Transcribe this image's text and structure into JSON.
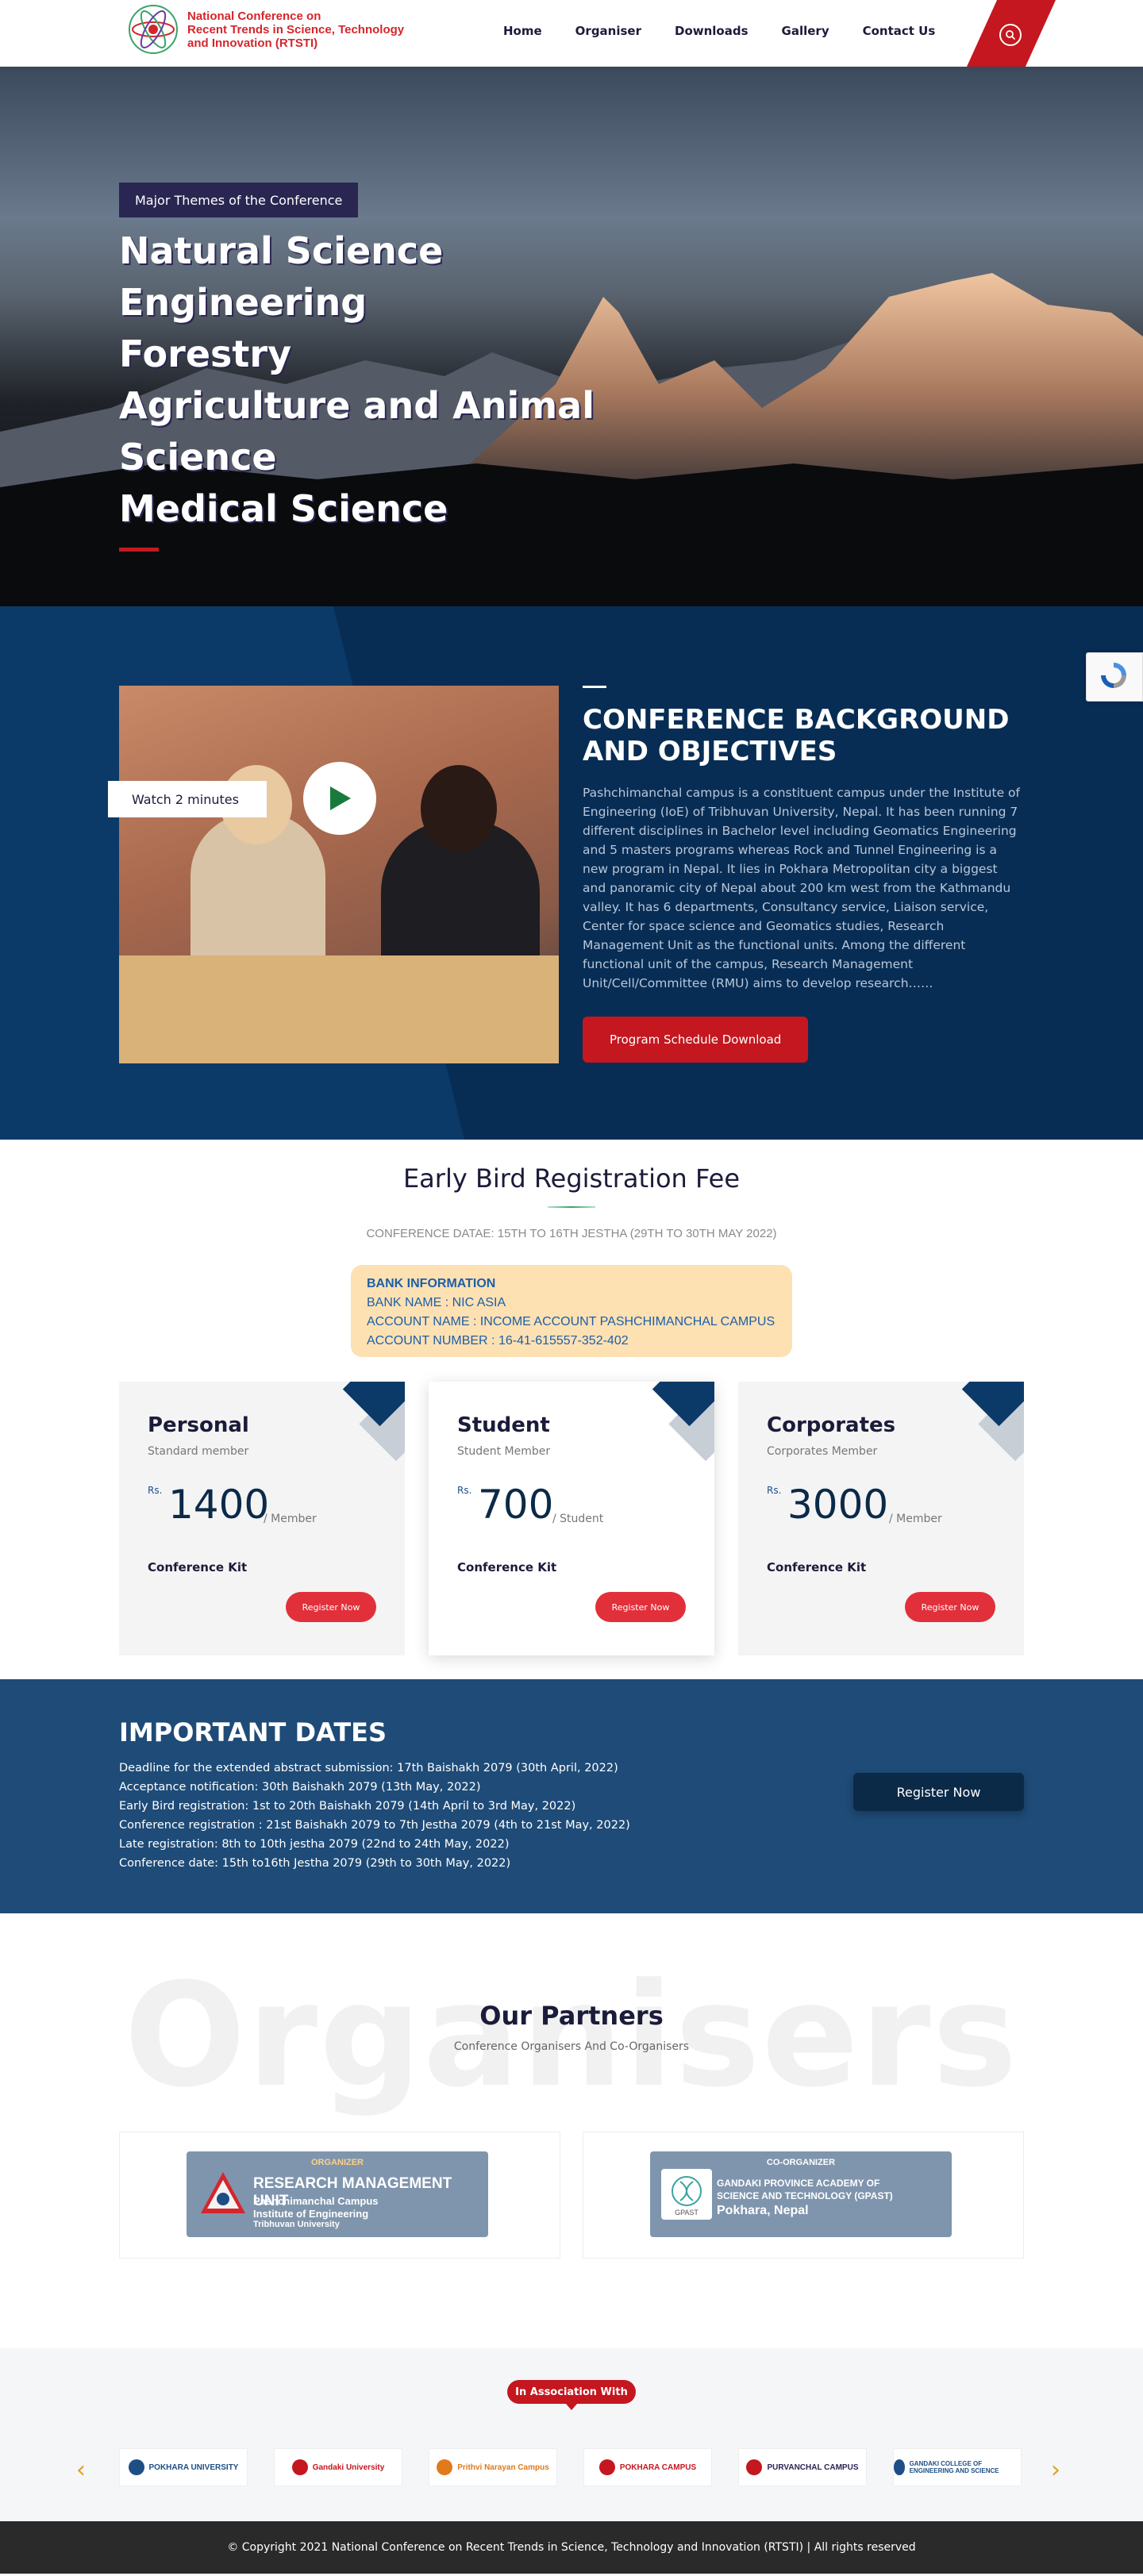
{
  "brand": {
    "name_line1": "National Conference on",
    "name_line2": "Recent Trends in Science, Technology",
    "name_line3": "and Innovation  (RTSTI)"
  },
  "nav": {
    "items": [
      "Home",
      "Organiser",
      "Downloads",
      "Gallery",
      "Contact Us"
    ]
  },
  "hero": {
    "badge": "Major Themes of the Conference",
    "themes": [
      "Natural Science",
      "Engineering",
      "Forestry",
      "Agriculture and Animal",
      "Science",
      "Medical Science"
    ]
  },
  "background": {
    "watch_label": "Watch 2 minutes",
    "title": "CONFERENCE BACKGROUND AND OBJECTIVES",
    "paragraph": "Pashchimanchal campus is a constituent campus under the Institute of Engineering (IoE) of Tribhuvan University, Nepal. It has been running 7 different disciplines in Bachelor level including Geomatics Engineering and 5 masters programs whereas Rock and Tunnel Engineering is a new program in Nepal. It lies in Pokhara Metropolitan city a biggest and panoramic city of Nepal about 200 km west from the Kathmandu valley. It has 6 departments, Consultancy service, Liaison service, Center for space science and Geomatics studies, Research Management Unit as the functional units. Among the different functional unit of the campus, Research Management Unit/Cell/Committee (RMU) aims to develop research……",
    "button": "Program Schedule Download"
  },
  "early_bird": {
    "title": "Early Bird Registration Fee",
    "date": "CONFERENCE DATAE: 15TH TO 16TH JESTHA (29TH TO 30TH MAY 2022)",
    "bank": {
      "heading": "BANK INFORMATION",
      "name": "BANK NAME : NIC ASIA",
      "account_name": "ACCOUNT NAME : INCOME ACCOUNT PASHCHIMANCHAL CAMPUS",
      "account_number": "ACCOUNT NUMBER : 16-41-615557-352-402"
    },
    "plans": [
      {
        "name": "Personal",
        "sub": "Standard member",
        "currency": "Rs.",
        "price": "1400",
        "per": "/ Member",
        "kit": "Conference Kit",
        "button": "Register Now"
      },
      {
        "name": "Student",
        "sub": "Student Member",
        "currency": "Rs.",
        "price": "700",
        "per": "/ Student",
        "kit": "Conference Kit",
        "button": "Register Now"
      },
      {
        "name": "Corporates",
        "sub": "Corporates Member",
        "currency": "Rs.",
        "price": "3000",
        "per": "/ Member",
        "kit": "Conference Kit",
        "button": "Register Now"
      }
    ]
  },
  "dates": {
    "title": "IMPORTANT DATES",
    "items": [
      "Deadline for the extended abstract submission: 17th Baishakh 2079 (30th April, 2022)",
      "Acceptance notification: 30th Baishakh 2079 (13th May, 2022)",
      "Early Bird registration: 1st to 20th Baishakh 2079 (14th April to 3rd May, 2022)",
      "Conference registration : 21st Baishakh 2079 to 7th Jestha 2079 (4th to 21st May, 2022)",
      "Late registration: 8th to 10th jestha 2079 (22nd to 24th May, 2022)",
      "Conference date: 15th to16th Jestha 2079 (29th to 30th May, 2022)"
    ],
    "button": "Register Now"
  },
  "partners": {
    "watermark": "Organisers",
    "title": "Our Partners",
    "subtitle": "Conference Organisers And Co-Organisers",
    "organizer": {
      "tag": "ORGANIZER",
      "line1": "RESEARCH MANAGEMENT UNIT",
      "line2": "Pashchimanchal Campus",
      "line3": "Institute of Engineering",
      "line4": "Tribhuvan University"
    },
    "co_organizer": {
      "tag": "CO-ORGANIZER",
      "line1": "GANDAKI PROVINCE ACADEMY OF",
      "line2": "SCIENCE AND TECHNOLOGY (GPAST)",
      "line3": "Pokhara, Nepal",
      "logo_text": "GPAST"
    }
  },
  "association": {
    "badge": "In Association With",
    "logos": [
      "POKHARA UNIVERSITY",
      "Gandaki University",
      "Prithvi Narayan Campus",
      "POKHARA CAMPUS",
      "PURVANCHAL CAMPUS",
      "GANDAKI COLLEGE OF ENGINEERING AND SCIENCE"
    ]
  },
  "footer": {
    "text": "© Copyright 2021 National Conference on Recent Trends in Science, Technology and Innovation (RTSTI) | All rights reserved"
  },
  "colors": {
    "brand_red": "#c4171f",
    "navy": "#0b3a68",
    "dates_blue": "#1e4b77"
  }
}
